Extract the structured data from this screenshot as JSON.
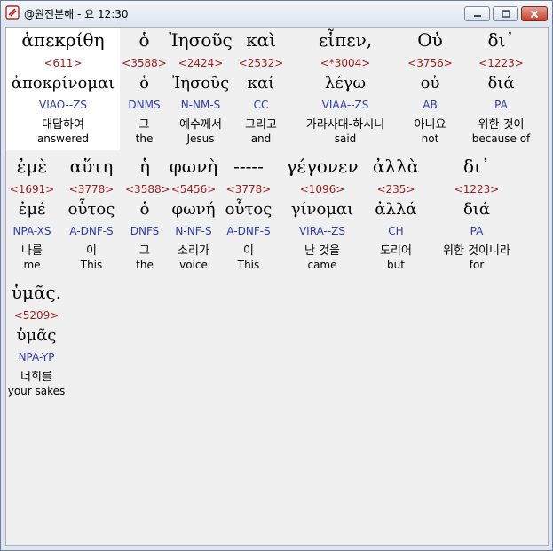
{
  "window": {
    "title": "@원전분해 - 요 12:30"
  },
  "rows": [
    {
      "cells": [
        {
          "greek": "ἀπεκρίθη",
          "strong": "<611>",
          "lex": "ἀποκρίνομαι",
          "parse": "VIAO--ZS",
          "korean": "대답하여",
          "english": "answered"
        },
        {
          "greek": "ὁ",
          "strong": "<3588>",
          "lex": "ὁ",
          "parse": "DNMS",
          "korean": "그",
          "english": "the"
        },
        {
          "greek": "Ἰησοῦς",
          "strong": "<2424>",
          "lex": "Ἰησοῦς",
          "parse": "N-NM-S",
          "korean": "예수께서",
          "english": "Jesus"
        },
        {
          "greek": "καὶ",
          "strong": "<2532>",
          "lex": "καί",
          "parse": "CC",
          "korean": "그리고",
          "english": "and"
        },
        {
          "greek": "εἶπεν,",
          "strong": "<*3004>",
          "lex": "λέγω",
          "parse": "VIAA--ZS",
          "korean": "가라사대-하시니",
          "english": "said"
        },
        {
          "greek": "Οὐ",
          "strong": "<3756>",
          "lex": "οὐ",
          "parse": "AB",
          "korean": "아니요",
          "english": "not"
        },
        {
          "greek": "δι᾽",
          "strong": "<1223>",
          "lex": "διά",
          "parse": "PA",
          "korean": "위한 것이",
          "english": "because of"
        }
      ]
    },
    {
      "cells": [
        {
          "greek": "ἐμὲ",
          "strong": "<1691>",
          "lex": "ἐμέ",
          "parse": "NPA-XS",
          "korean": "나를",
          "english": "me"
        },
        {
          "greek": "αὕτη",
          "strong": "<3778>",
          "lex": "οὗτος",
          "parse": "A-DNF-S",
          "korean": "이",
          "english": "This"
        },
        {
          "greek": "ἡ",
          "strong": "<3588>",
          "lex": "ὁ",
          "parse": "DNFS",
          "korean": "그",
          "english": "the"
        },
        {
          "greek": "φωνὴ",
          "strong": "<5456>",
          "lex": "φωνή",
          "parse": "N-NF-S",
          "korean": "소리가",
          "english": "voice"
        },
        {
          "greek": "-----",
          "strong": "<3778>",
          "lex": "οὗτος",
          "parse": "A-DNF-S",
          "korean": "이",
          "english": "This"
        },
        {
          "greek": "γέγονεν",
          "strong": "<1096>",
          "lex": "γίνομαι",
          "parse": "VIRA--ZS",
          "korean": "난 것을",
          "english": "came"
        },
        {
          "greek": "ἀλλὰ",
          "strong": "<235>",
          "lex": "ἀλλά",
          "parse": "CH",
          "korean": "도리어",
          "english": "but"
        },
        {
          "greek": "δι᾽",
          "strong": "<1223>",
          "lex": "διά",
          "parse": "PA",
          "korean": "위한 것이니라",
          "english": "for"
        }
      ]
    },
    {
      "cells": [
        {
          "greek": "ὑμᾶς.",
          "strong": "<5209>",
          "lex": "ὑμᾶς",
          "parse": "NPA-YP",
          "korean": "너희를",
          "english": "your sakes"
        }
      ]
    }
  ],
  "colors": {
    "strong": "#9c1c1c",
    "parse": "#2a3aa8",
    "background": "#f0f0f0",
    "highlight": "#ffffff"
  }
}
